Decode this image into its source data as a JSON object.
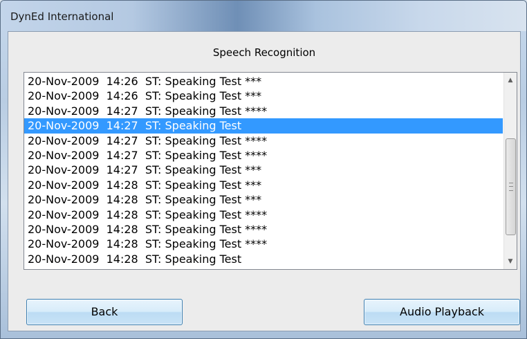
{
  "window": {
    "title": "DynEd International"
  },
  "heading": "Speech Recognition",
  "list": {
    "items": [
      "20-Nov-2009  14:26  ST: Speaking Test ***",
      "20-Nov-2009  14:26  ST: Speaking Test ***",
      "20-Nov-2009  14:27  ST: Speaking Test ****",
      "20-Nov-2009  14:27  ST: Speaking Test",
      "20-Nov-2009  14:27  ST: Speaking Test ****",
      "20-Nov-2009  14:27  ST: Speaking Test ****",
      "20-Nov-2009  14:27  ST: Speaking Test ***",
      "20-Nov-2009  14:28  ST: Speaking Test ***",
      "20-Nov-2009  14:28  ST: Speaking Test ***",
      "20-Nov-2009  14:28  ST: Speaking Test ****",
      "20-Nov-2009  14:28  ST: Speaking Test ****",
      "20-Nov-2009  14:28  ST: Speaking Test ****",
      "20-Nov-2009  14:28  ST: Speaking Test"
    ],
    "selected_index": 3,
    "selection_color": "#3399ff"
  },
  "scrollbar": {
    "up_icon": "▲",
    "down_icon": "▼"
  },
  "buttons": {
    "back": "Back",
    "audio_playback": "Audio Playback"
  }
}
